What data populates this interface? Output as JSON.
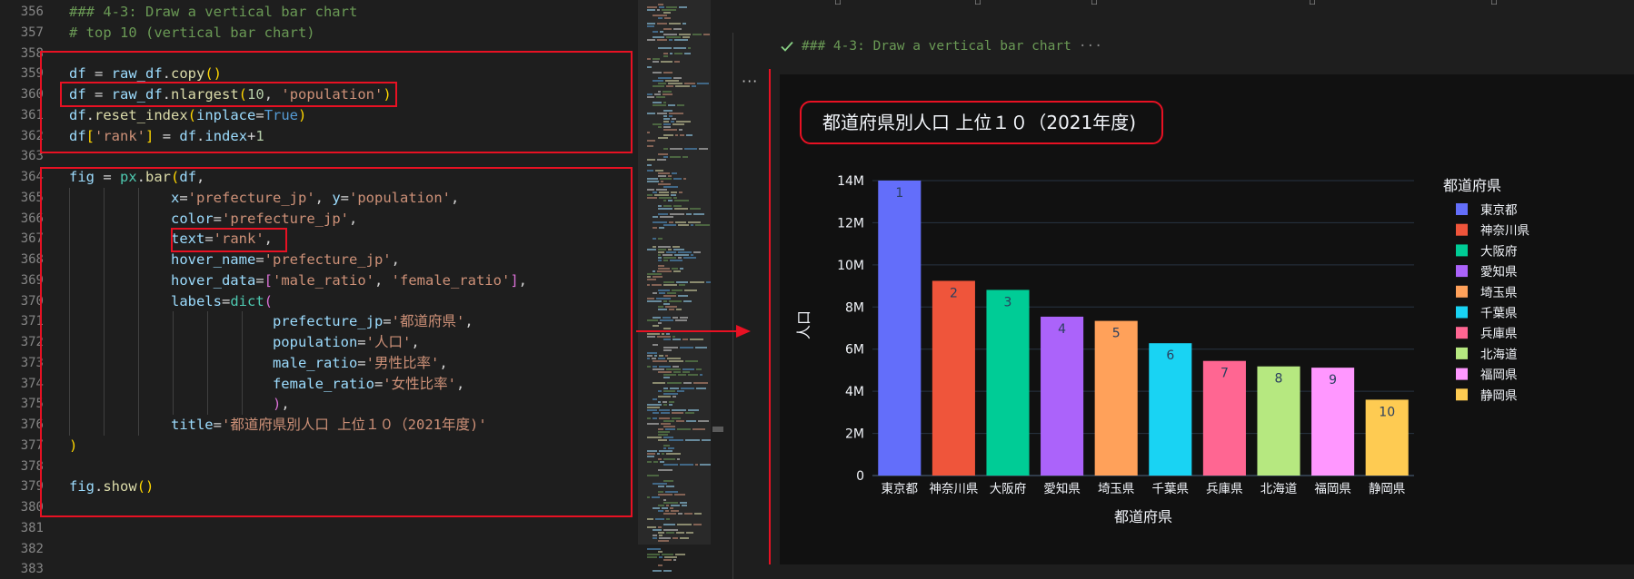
{
  "editor": {
    "lines": [
      {
        "no": "356",
        "tokens": [
          {
            "c": "cm",
            "t": "### 4-3: Draw a vertical bar chart"
          }
        ]
      },
      {
        "no": "357",
        "tokens": [
          {
            "c": "cm",
            "t": "# top 10 (vertical bar chart)"
          }
        ]
      },
      {
        "no": "358",
        "tokens": []
      },
      {
        "no": "359",
        "tokens": [
          {
            "c": "v",
            "t": "df"
          },
          {
            "c": "o",
            "t": " = "
          },
          {
            "c": "v",
            "t": "raw_df"
          },
          {
            "c": "o",
            "t": "."
          },
          {
            "c": "f",
            "t": "copy"
          },
          {
            "c": "b1",
            "t": "()"
          }
        ]
      },
      {
        "no": "360",
        "tokens": [
          {
            "c": "v",
            "t": "df"
          },
          {
            "c": "o",
            "t": " = "
          },
          {
            "c": "v",
            "t": "raw_df"
          },
          {
            "c": "o",
            "t": "."
          },
          {
            "c": "f",
            "t": "nlargest"
          },
          {
            "c": "b1",
            "t": "("
          },
          {
            "c": "n",
            "t": "10"
          },
          {
            "c": "o",
            "t": ", "
          },
          {
            "c": "s",
            "t": "'population'"
          },
          {
            "c": "b1",
            "t": ")"
          }
        ]
      },
      {
        "no": "361",
        "tokens": [
          {
            "c": "v",
            "t": "df"
          },
          {
            "c": "o",
            "t": "."
          },
          {
            "c": "f",
            "t": "reset_index"
          },
          {
            "c": "b1",
            "t": "("
          },
          {
            "c": "v",
            "t": "inplace"
          },
          {
            "c": "o",
            "t": "="
          },
          {
            "c": "k",
            "t": "True"
          },
          {
            "c": "b1",
            "t": ")"
          }
        ]
      },
      {
        "no": "362",
        "tokens": [
          {
            "c": "v",
            "t": "df"
          },
          {
            "c": "b1",
            "t": "["
          },
          {
            "c": "s",
            "t": "'rank'"
          },
          {
            "c": "b1",
            "t": "]"
          },
          {
            "c": "o",
            "t": " = "
          },
          {
            "c": "v",
            "t": "df"
          },
          {
            "c": "o",
            "t": "."
          },
          {
            "c": "v",
            "t": "index"
          },
          {
            "c": "o",
            "t": "+"
          },
          {
            "c": "n",
            "t": "1"
          }
        ]
      },
      {
        "no": "363",
        "tokens": []
      },
      {
        "no": "364",
        "tokens": [
          {
            "c": "v",
            "t": "fig"
          },
          {
            "c": "o",
            "t": " = "
          },
          {
            "c": "fn",
            "t": "px"
          },
          {
            "c": "o",
            "t": "."
          },
          {
            "c": "f",
            "t": "bar"
          },
          {
            "c": "b1",
            "t": "("
          },
          {
            "c": "v",
            "t": "df"
          },
          {
            "c": "o",
            "t": ","
          }
        ]
      },
      {
        "no": "365",
        "tokens": [
          {
            "c": "o",
            "t": "            "
          },
          {
            "c": "v",
            "t": "x"
          },
          {
            "c": "o",
            "t": "="
          },
          {
            "c": "s",
            "t": "'prefecture_jp'"
          },
          {
            "c": "o",
            "t": ", "
          },
          {
            "c": "v",
            "t": "y"
          },
          {
            "c": "o",
            "t": "="
          },
          {
            "c": "s",
            "t": "'population'"
          },
          {
            "c": "o",
            "t": ","
          }
        ]
      },
      {
        "no": "366",
        "tokens": [
          {
            "c": "o",
            "t": "            "
          },
          {
            "c": "v",
            "t": "color"
          },
          {
            "c": "o",
            "t": "="
          },
          {
            "c": "s",
            "t": "'prefecture_jp'"
          },
          {
            "c": "o",
            "t": ","
          }
        ]
      },
      {
        "no": "367",
        "tokens": [
          {
            "c": "o",
            "t": "            "
          },
          {
            "c": "v",
            "t": "text"
          },
          {
            "c": "o",
            "t": "="
          },
          {
            "c": "s",
            "t": "'rank'"
          },
          {
            "c": "o",
            "t": ","
          }
        ]
      },
      {
        "no": "368",
        "tokens": [
          {
            "c": "o",
            "t": "            "
          },
          {
            "c": "v",
            "t": "hover_name"
          },
          {
            "c": "o",
            "t": "="
          },
          {
            "c": "s",
            "t": "'prefecture_jp'"
          },
          {
            "c": "o",
            "t": ","
          }
        ]
      },
      {
        "no": "369",
        "tokens": [
          {
            "c": "o",
            "t": "            "
          },
          {
            "c": "v",
            "t": "hover_data"
          },
          {
            "c": "o",
            "t": "="
          },
          {
            "c": "b2",
            "t": "["
          },
          {
            "c": "s",
            "t": "'male_ratio'"
          },
          {
            "c": "o",
            "t": ", "
          },
          {
            "c": "s",
            "t": "'female_ratio'"
          },
          {
            "c": "b2",
            "t": "]"
          },
          {
            "c": "o",
            "t": ","
          }
        ]
      },
      {
        "no": "370",
        "tokens": [
          {
            "c": "o",
            "t": "            "
          },
          {
            "c": "v",
            "t": "labels"
          },
          {
            "c": "o",
            "t": "="
          },
          {
            "c": "fn",
            "t": "dict"
          },
          {
            "c": "b2",
            "t": "("
          }
        ]
      },
      {
        "no": "371",
        "tokens": [
          {
            "c": "o",
            "t": "                        "
          },
          {
            "c": "v",
            "t": "prefecture_jp"
          },
          {
            "c": "o",
            "t": "="
          },
          {
            "c": "s",
            "t": "'都道府県'"
          },
          {
            "c": "o",
            "t": ","
          }
        ]
      },
      {
        "no": "372",
        "tokens": [
          {
            "c": "o",
            "t": "                        "
          },
          {
            "c": "v",
            "t": "population"
          },
          {
            "c": "o",
            "t": "="
          },
          {
            "c": "s",
            "t": "'人口'"
          },
          {
            "c": "o",
            "t": ","
          }
        ]
      },
      {
        "no": "373",
        "tokens": [
          {
            "c": "o",
            "t": "                        "
          },
          {
            "c": "v",
            "t": "male_ratio"
          },
          {
            "c": "o",
            "t": "="
          },
          {
            "c": "s",
            "t": "'男性比率'"
          },
          {
            "c": "o",
            "t": ","
          }
        ]
      },
      {
        "no": "374",
        "tokens": [
          {
            "c": "o",
            "t": "                        "
          },
          {
            "c": "v",
            "t": "female_ratio"
          },
          {
            "c": "o",
            "t": "="
          },
          {
            "c": "s",
            "t": "'女性比率'"
          },
          {
            "c": "o",
            "t": ","
          }
        ]
      },
      {
        "no": "375",
        "tokens": [
          {
            "c": "o",
            "t": "                        "
          },
          {
            "c": "b2",
            "t": ")"
          },
          {
            "c": "o",
            "t": ","
          }
        ]
      },
      {
        "no": "376",
        "tokens": [
          {
            "c": "o",
            "t": "            "
          },
          {
            "c": "v",
            "t": "title"
          },
          {
            "c": "o",
            "t": "="
          },
          {
            "c": "s",
            "t": "'都道府県別人口 上位１０（2021年度)'"
          }
        ]
      },
      {
        "no": "377",
        "tokens": [
          {
            "c": "b1",
            "t": ")"
          }
        ]
      },
      {
        "no": "378",
        "tokens": []
      },
      {
        "no": "379",
        "tokens": [
          {
            "c": "v",
            "t": "fig"
          },
          {
            "c": "o",
            "t": "."
          },
          {
            "c": "f",
            "t": "show"
          },
          {
            "c": "b1",
            "t": "()"
          }
        ]
      },
      {
        "no": "380",
        "tokens": []
      },
      {
        "no": "381",
        "tokens": []
      },
      {
        "no": "382",
        "tokens": []
      },
      {
        "no": "383",
        "tokens": []
      }
    ]
  },
  "output": {
    "cell_title": "### 4-3: Draw a vertical bar chart",
    "collapsed_marker": "···",
    "more_actions": "···"
  },
  "colors": {
    "accent_red": "#e81123",
    "plot_bg": "#111111",
    "grid": "#283442",
    "text": "#f2f5fa"
  },
  "chart_data": {
    "type": "bar",
    "title": "都道府県別人口 上位１０（2021年度)",
    "xlabel": "都道府県",
    "ylabel": "人口",
    "legend_title": "都道府県",
    "legend_position": "right",
    "grid": true,
    "ylim": [
      0,
      14300000
    ],
    "yticks": [
      0,
      2000000,
      4000000,
      6000000,
      8000000,
      10000000,
      12000000,
      14000000
    ],
    "yticklabels": [
      "0",
      "2M",
      "4M",
      "6M",
      "8M",
      "10M",
      "12M",
      "14M"
    ],
    "categories": [
      "東京都",
      "神奈川県",
      "大阪府",
      "愛知県",
      "埼玉県",
      "千葉県",
      "兵庫県",
      "北海道",
      "福岡県",
      "静岡県"
    ],
    "values": [
      14000000,
      9240000,
      8810000,
      7540000,
      7340000,
      6280000,
      5440000,
      5180000,
      5120000,
      3600000
    ],
    "bar_labels": [
      "1",
      "2",
      "3",
      "4",
      "5",
      "6",
      "7",
      "8",
      "9",
      "10"
    ],
    "colors": [
      "#636efa",
      "#ef553b",
      "#00cc96",
      "#ab63fa",
      "#ffa15a",
      "#19d3f3",
      "#ff6692",
      "#b6e880",
      "#ff97ff",
      "#fecb52"
    ]
  }
}
